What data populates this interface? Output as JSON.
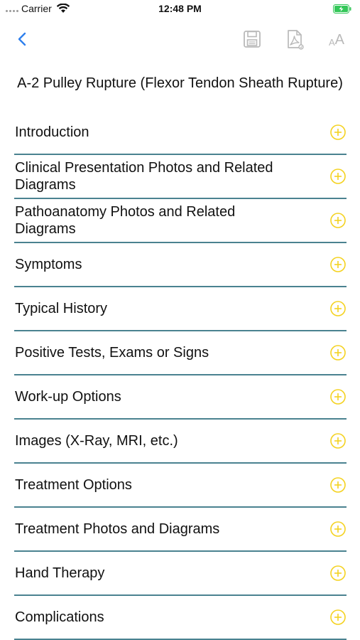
{
  "status_bar": {
    "carrier": "Carrier",
    "time": "12:48 PM"
  },
  "nav": {
    "back_icon": "chevron-left-icon",
    "save_icon": "save-icon",
    "pdf_icon": "pdf-icon",
    "font_size_label_small": "A",
    "font_size_label_big": "A"
  },
  "page": {
    "title": "A-2 Pulley Rupture (Flexor Tendon Sheath Rupture)"
  },
  "sections": [
    {
      "label": "Introduction"
    },
    {
      "label": "Clinical Presentation Photos and Related Diagrams"
    },
    {
      "label": "Pathoanatomy Photos and Related Diagrams"
    },
    {
      "label": "Symptoms"
    },
    {
      "label": "Typical History"
    },
    {
      "label": "Positive Tests, Exams or Signs"
    },
    {
      "label": "Work-up Options"
    },
    {
      "label": "Images (X-Ray, MRI, etc.)"
    },
    {
      "label": "Treatment Options"
    },
    {
      "label": "Treatment Photos and Diagrams"
    },
    {
      "label": "Hand Therapy"
    },
    {
      "label": "Complications"
    }
  ],
  "colors": {
    "accent_blue": "#2f80ed",
    "expand_yellow": "#f4d21f",
    "divider": "#4a8290",
    "toolbar_gray": "#b9b9b9",
    "battery_green": "#34c759"
  }
}
